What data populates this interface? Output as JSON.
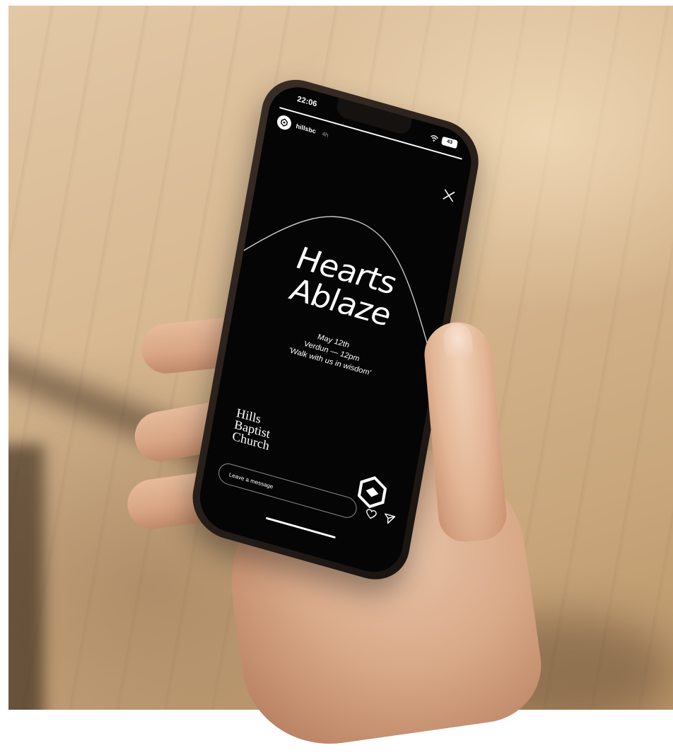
{
  "status_bar": {
    "time": "22:06",
    "battery": "43"
  },
  "story": {
    "username": "hillsbc",
    "time_ago": "4h",
    "progress": 1.0,
    "title_line1": "Hearts",
    "title_line2": "Ablaze",
    "date": "May 12th",
    "location_time": "Verdun — 12pm",
    "tagline": "'Walk with us in wisdom'",
    "church_line1": "Hills",
    "church_line2": "Baptist",
    "church_line3": "Church"
  },
  "reply": {
    "placeholder": "Leave a message"
  },
  "icons": {
    "avatar": "church-logo-icon",
    "close": "close-icon",
    "like": "heart-icon",
    "send": "send-icon",
    "wifi": "wifi-icon",
    "battery": "battery-icon",
    "brand": "church-logo-icon"
  },
  "colors": {
    "screen_bg": "#050505",
    "text": "#ffffff"
  }
}
